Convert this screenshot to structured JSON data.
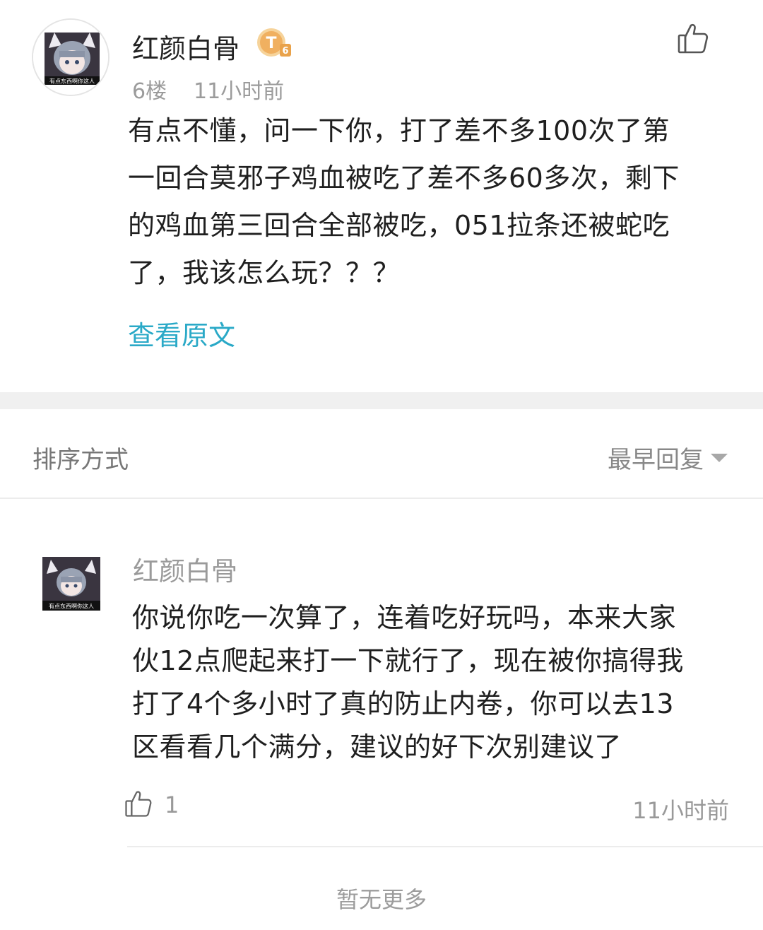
{
  "post": {
    "author": "红颜白骨",
    "avatar_caption": "有点东西啊你这人",
    "level_badge": "T6",
    "floor": "6楼",
    "time": "11小时前",
    "content_lines": [
      "有点不懂，问一下你，打了差不多100次了第",
      "一回合莫邪子鸡血被吃了差不多60多次，剩下",
      "的鸡血第三回合全部被吃，051拉条还被蛇吃",
      "了，我该怎么玩？？？"
    ],
    "view_original": "查看原文"
  },
  "sort": {
    "label": "排序方式",
    "selected": "最早回复"
  },
  "reply": {
    "author": "红颜白骨",
    "content_lines": [
      "你说你吃一次算了，连着吃好玩吗，本来大家",
      "伙12点爬起来打一下就行了，现在被你搞得我",
      "打了4个多小时了真的防止内卷，你可以去13",
      "区看看几个满分，建议的好下次别建议了"
    ],
    "like_count": "1",
    "time": "11小时前"
  },
  "footer": {
    "no_more": "暂无更多"
  },
  "colors": {
    "link": "#2aa9c7",
    "muted": "#9b9b9b",
    "separator": "#f0f0f0",
    "badge": "#f0b060"
  },
  "icons": {
    "like": "thumbs-up-icon",
    "sort_caret": "caret-down-icon"
  }
}
